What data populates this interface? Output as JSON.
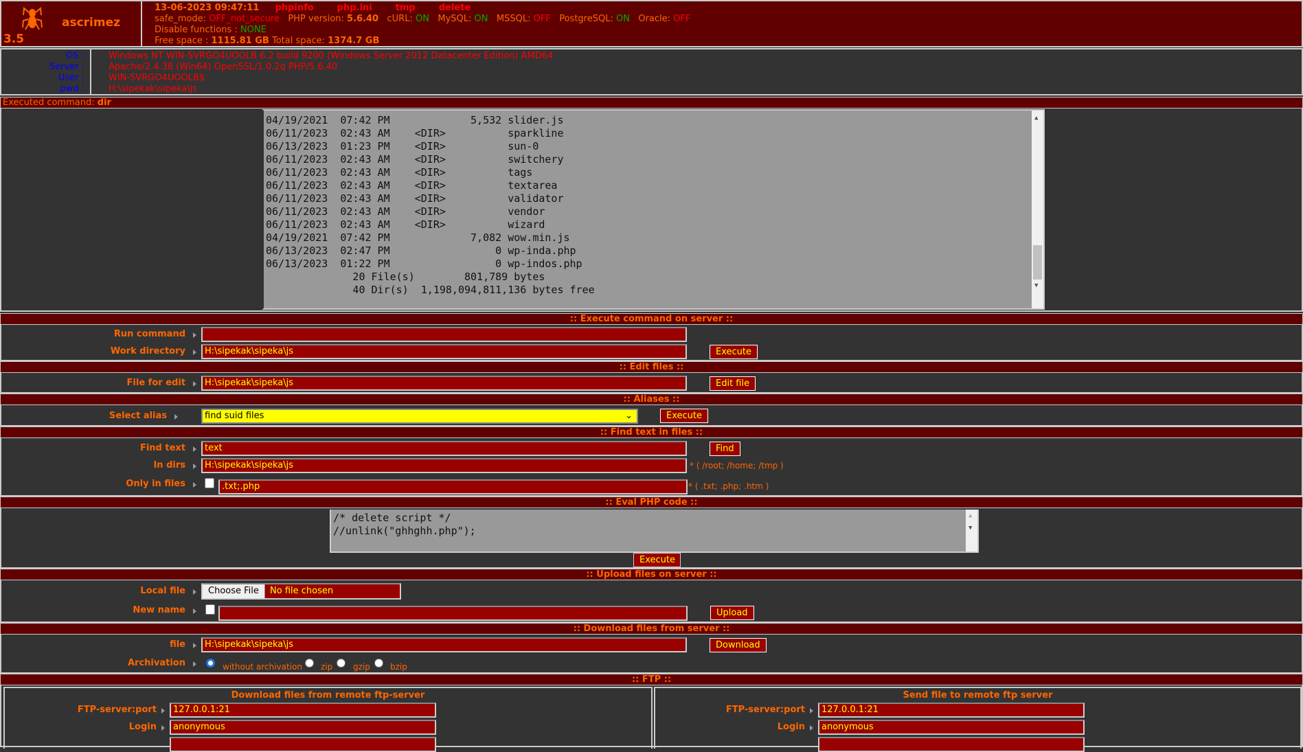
{
  "header": {
    "app_name": "ascrimez",
    "version": "3.5",
    "datetime": "13-06-2023 09:47:11",
    "links": [
      "phpinfo",
      "php.ini",
      "tmp",
      "delete"
    ],
    "safe_mode_label": "safe_mode:",
    "safe_mode_value": "OFF_not_secure",
    "php_version_label": "PHP version:",
    "php_version_value": "5.6.40",
    "curl_label": "cURL:",
    "curl_value": "ON",
    "mysql_label": "MySQL:",
    "mysql_value": "ON",
    "mssql_label": "MSSQL:",
    "mssql_value": "OFF",
    "pgsql_label": "PostgreSQL:",
    "pgsql_value": "ON",
    "oracle_label": "Oracle:",
    "oracle_value": "OFF",
    "disable_functions_label": "Disable functions :",
    "disable_functions_value": "NONE",
    "free_space_label": "Free space :",
    "free_space_value": "1115.81 GB",
    "total_space_label": "Total space:",
    "total_space_value": "1374.7 GB",
    "icon": "spider-icon"
  },
  "system": {
    "labels": [
      "OS :",
      "Server :",
      "User :",
      "pwd :"
    ],
    "values": [
      "Windows NT WIN-SVRGO4UOOLB 6.2 build 9200 (Windows Server 2012 Datacenter Edition) AMD64",
      "Apache/2.4.38 (Win64) OpenSSL/1.0.2q PHP/5.6.40",
      "WIN-SVRGO4UOOLB$",
      "H:\\sipekak\\sipeka\\js"
    ]
  },
  "executed": {
    "label": "Executed command:",
    "command": "dir"
  },
  "output_lines": [
    "04/19/2021  07:42 PM             5,532 slider.js",
    "06/11/2023  02:43 AM    <DIR>          sparkline",
    "06/13/2023  01:23 PM    <DIR>          sun-0",
    "06/11/2023  02:43 AM    <DIR>          switchery",
    "06/11/2023  02:43 AM    <DIR>          tags",
    "06/11/2023  02:43 AM    <DIR>          textarea",
    "06/11/2023  02:43 AM    <DIR>          validator",
    "06/11/2023  02:43 AM    <DIR>          vendor",
    "06/11/2023  02:43 AM    <DIR>          wizard",
    "04/19/2021  07:42 PM             7,082 wow.min.js",
    "06/13/2023  02:47 PM                 0 wp-inda.php",
    "06/13/2023  01:22 PM                 0 wp-indos.php",
    "              20 File(s)        801,789 bytes",
    "              40 Dir(s)  1,198,094,811,136 bytes free"
  ],
  "exec_section": {
    "title": ":: Execute command on server ::",
    "run_label": "Run command",
    "run_value": "",
    "workdir_label": "Work directory",
    "workdir_value": "H:\\sipekak\\sipeka\\js",
    "button": "Execute"
  },
  "edit_section": {
    "title": ":: Edit files ::",
    "label": "File for edit",
    "value": "H:\\sipekak\\sipeka\\js",
    "button": "Edit file"
  },
  "alias_section": {
    "title": ":: Aliases ::",
    "label": "Select alias",
    "selected": "find suid files",
    "button": "Execute"
  },
  "find_section": {
    "title": ":: Find text in files ::",
    "text_label": "Find text",
    "text_value": "text",
    "button": "Find",
    "dirs_label": "In dirs",
    "dirs_value": "H:\\sipekak\\sipeka\\js",
    "dirs_note": "* ( /root; /home; /tmp )",
    "files_label": "Only in files",
    "files_value": ".txt;.php",
    "files_note": "* ( .txt; .php; .htm )"
  },
  "eval_section": {
    "title": ":: Eval PHP code ::",
    "code_lines": [
      "/* delete script */",
      "//unlink(\"ghhghh.php\");"
    ],
    "button": "Execute"
  },
  "upload_section": {
    "title": ":: Upload files on server ::",
    "local_label": "Local file",
    "choose_button": "Choose File",
    "no_file": "No file chosen",
    "newname_label": "New name",
    "newname_value": "",
    "button": "Upload"
  },
  "download_section": {
    "title": ":: Download files from server ::",
    "file_label": "file",
    "file_value": "H:\\sipekak\\sipeka\\js",
    "button": "Download",
    "arch_label": "Archivation",
    "options": [
      "without archivation",
      "zip",
      "gzip",
      "bzip"
    ],
    "selected": "without archivation"
  },
  "ftp_section": {
    "title": ":: FTP ::",
    "left": {
      "title": "Download files from remote ftp-server",
      "server_label": "FTP-server:port",
      "server_value": "127.0.0.1:21",
      "login_label": "Login",
      "login_value": "anonymous"
    },
    "right": {
      "title": "Send file to remote ftp server",
      "server_label": "FTP-server:port",
      "server_value": "127.0.0.1:21",
      "login_label": "Login",
      "login_value": "anonymous"
    }
  },
  "colors": {
    "header_bg": "#600000",
    "input_bg": "#990000",
    "input_text": "#ffff00",
    "label": "#ff6600",
    "value_red": "#ff0000",
    "on_green": "#00aa00",
    "sys_label_blue": "#0000ff",
    "page_bg": "#333333"
  }
}
